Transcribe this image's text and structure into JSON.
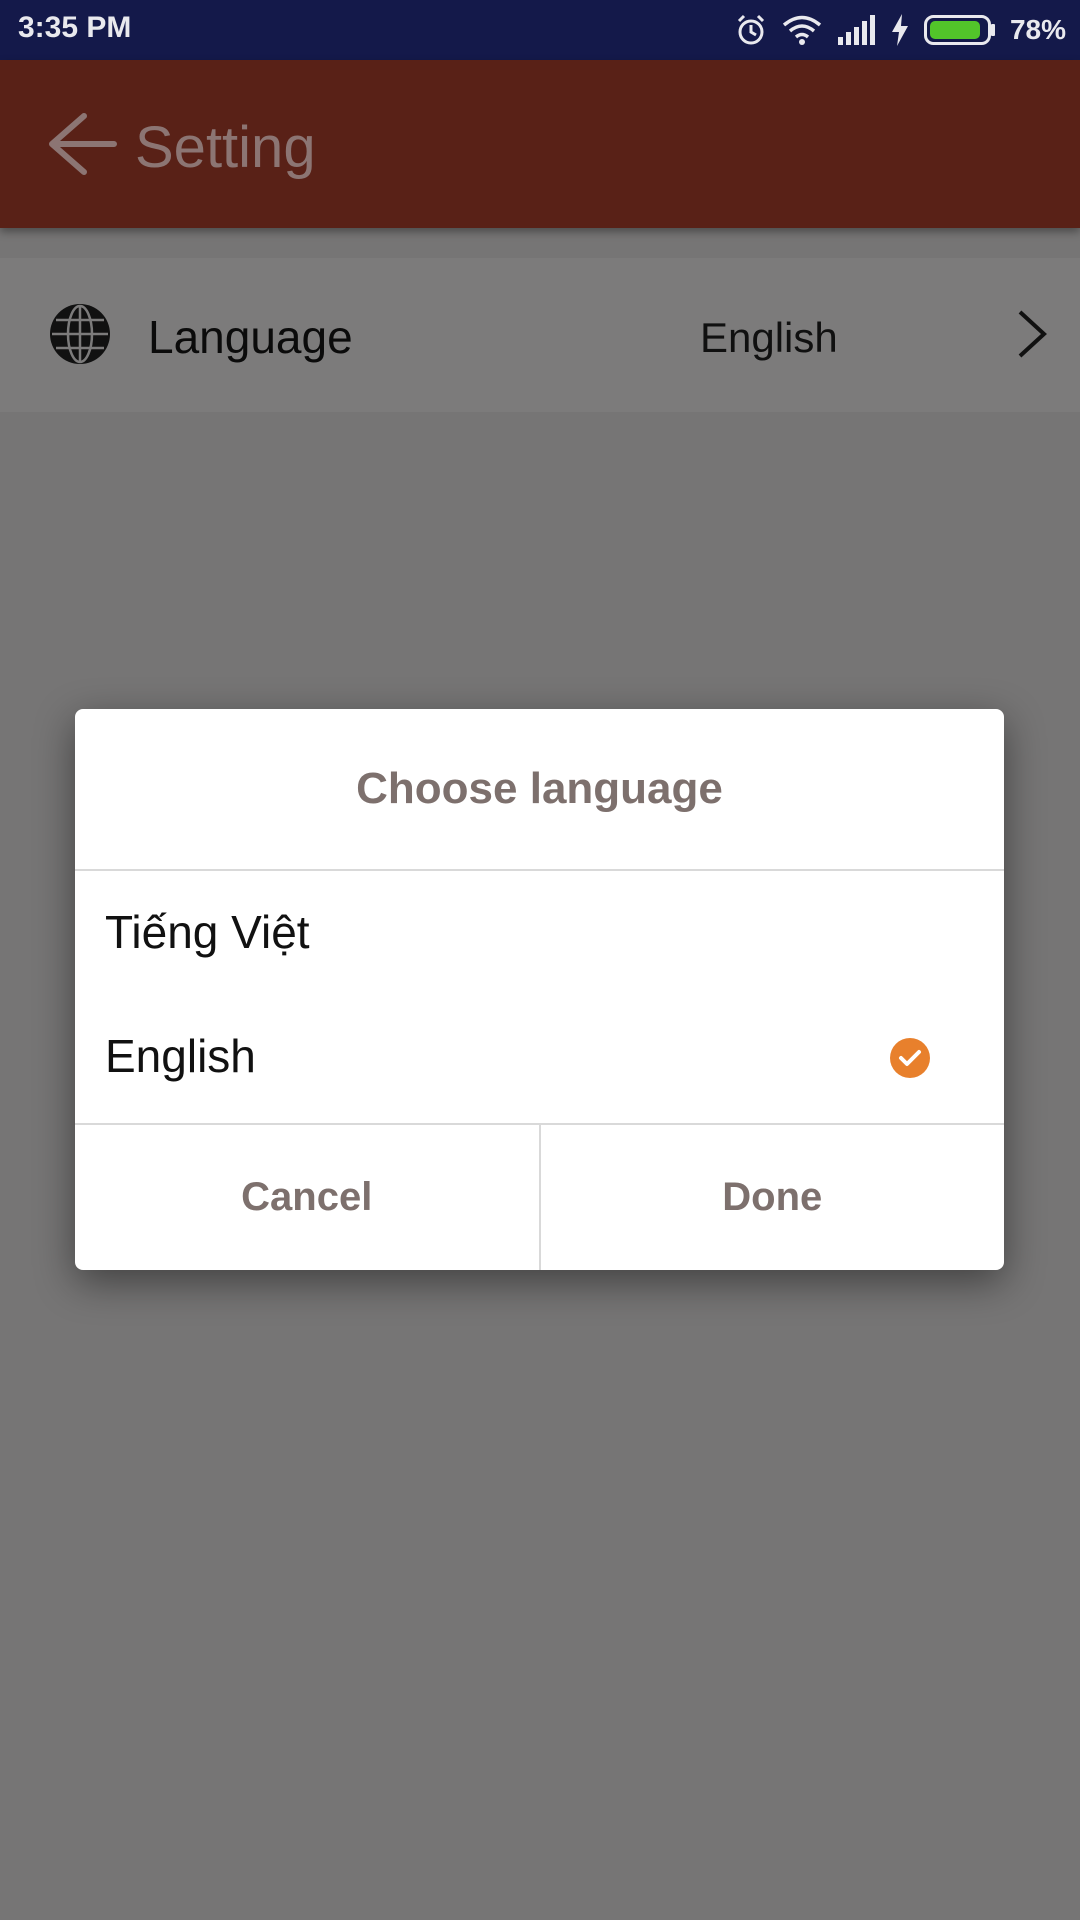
{
  "status_bar": {
    "time": "3:35 PM",
    "battery": "78%",
    "icons": [
      "alarm-icon",
      "wifi-icon",
      "signal-icon",
      "charging-icon",
      "battery-icon"
    ]
  },
  "app_bar": {
    "title": "Setting",
    "back_icon": "arrow-left-icon",
    "background": "#592117"
  },
  "settings": {
    "language_row": {
      "label": "Language",
      "value": "English",
      "icon": "globe-icon"
    }
  },
  "dialog": {
    "title": "Choose language",
    "options": [
      {
        "label": "Tiếng Việt",
        "selected": false
      },
      {
        "label": "English",
        "selected": true
      }
    ],
    "cancel_label": "Cancel",
    "done_label": "Done",
    "accent": "#e8802c"
  }
}
